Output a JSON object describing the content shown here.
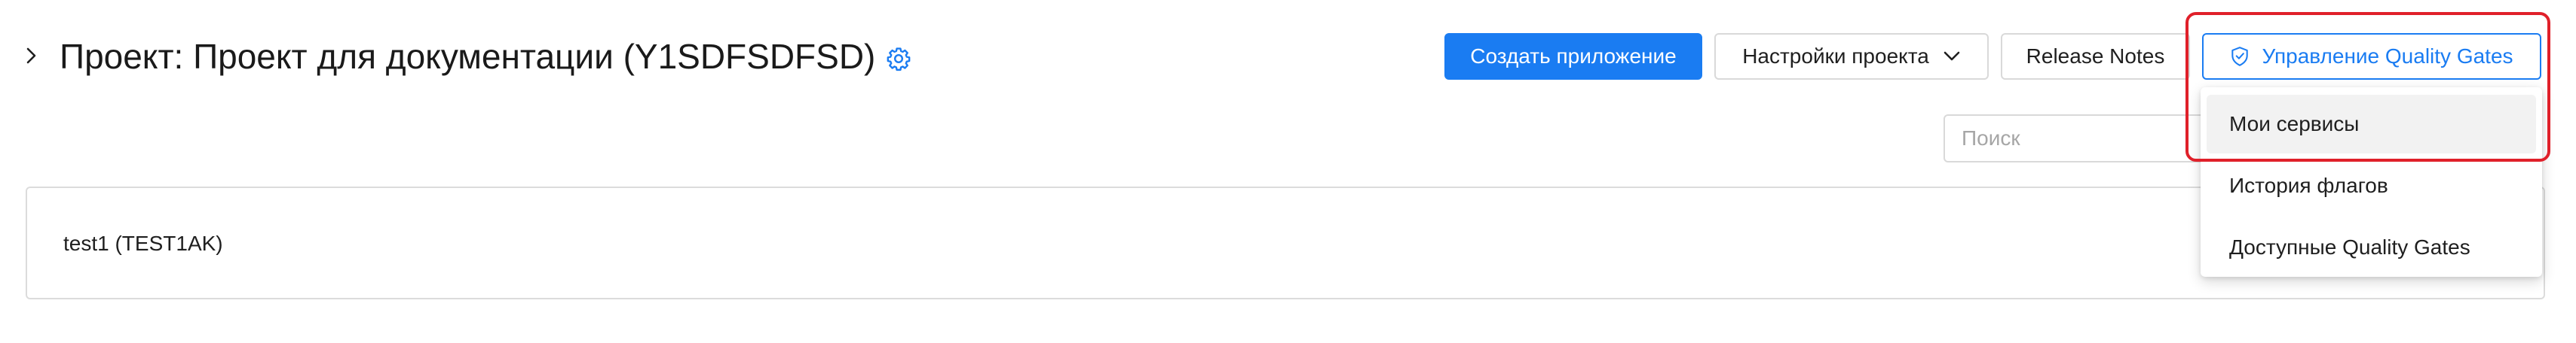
{
  "header": {
    "title": "Проект: Проект для документации (Y1SDFSDFSD)",
    "expand_icon": "chevron-right-icon",
    "settings_icon": "gear-icon"
  },
  "toolbar": {
    "create_app_label": "Создать приложение",
    "project_settings_label": "Настройки проекта",
    "release_notes_label": "Release Notes",
    "quality_gates_label": "Управление Quality Gates"
  },
  "search": {
    "placeholder": "Поиск",
    "value": ""
  },
  "projects": {
    "items": [
      {
        "label": "test1 (TEST1AK)"
      }
    ]
  },
  "dropdown": {
    "items": [
      {
        "label": "Мои сервисы"
      },
      {
        "label": "История флагов"
      },
      {
        "label": "Доступные Quality Gates"
      }
    ]
  },
  "colors": {
    "primary": "#1a7cf2",
    "highlight": "#e0202a",
    "border": "#d9d9d9",
    "hover": "#f2f2f2"
  }
}
